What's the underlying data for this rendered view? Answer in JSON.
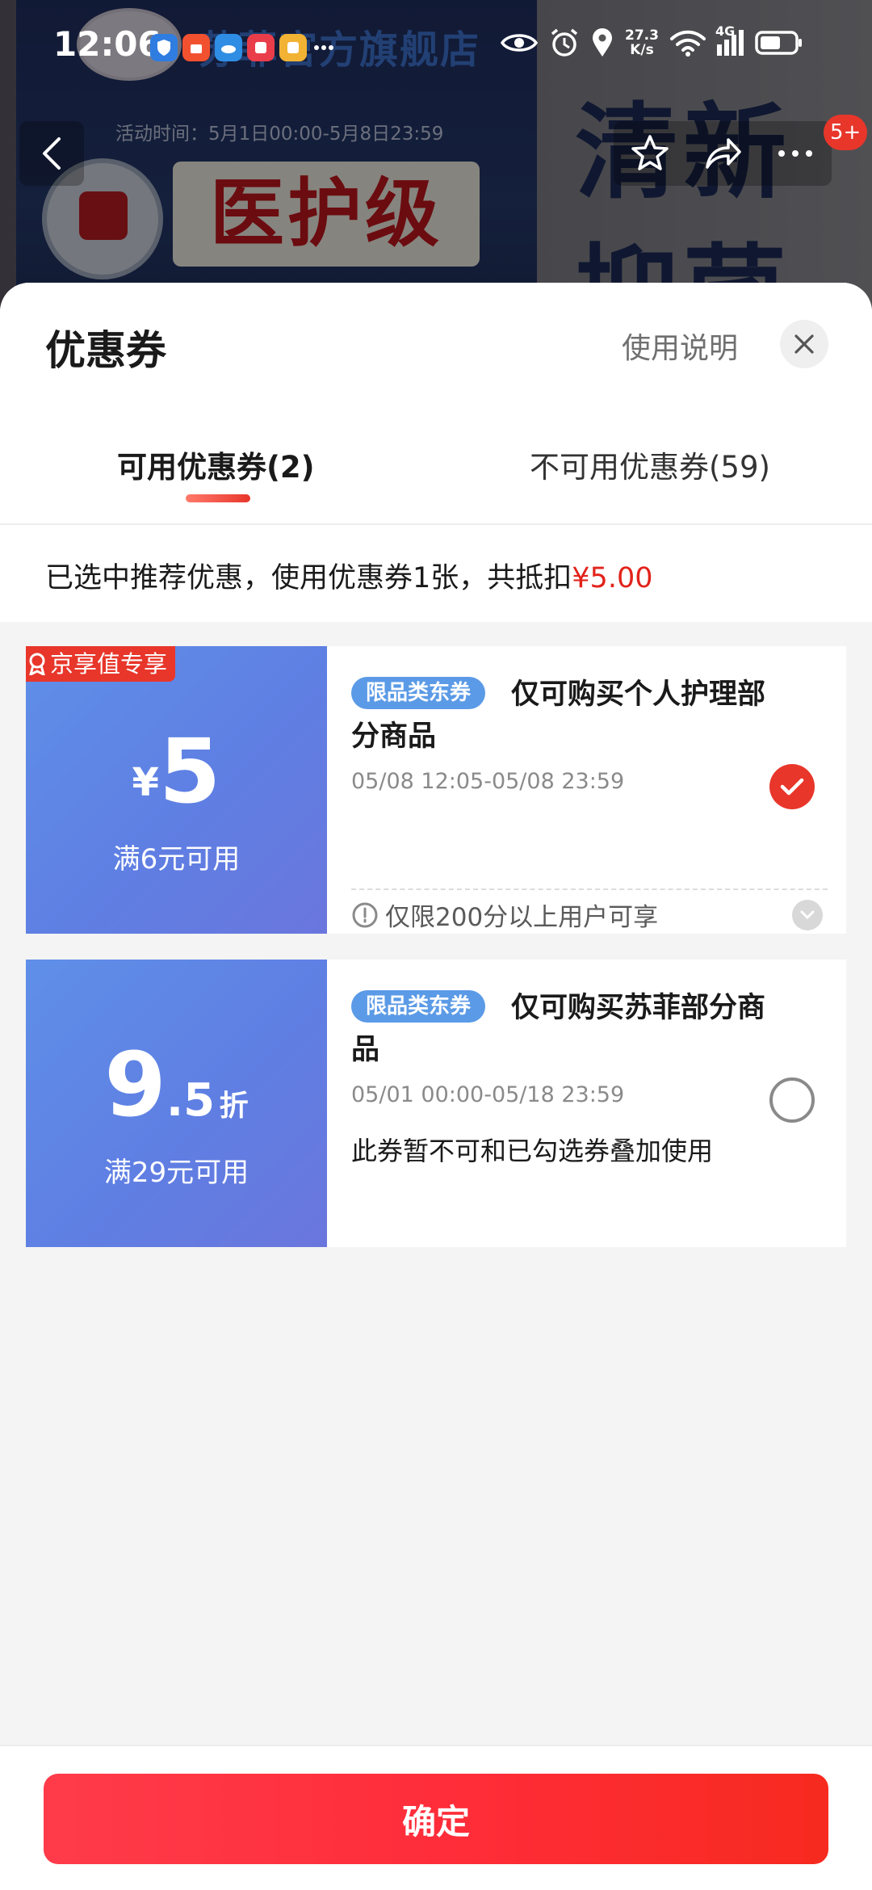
{
  "background": {
    "shop_name": "苏菲官方旗舰店",
    "activity_time": "活动时间：5月1日00:00-5月8日23:59",
    "medical_text": "医护级",
    "fresh_text_1": "清新",
    "fresh_text_2": "抑菌",
    "cart_badge": "5+"
  },
  "status_bar": {
    "time": "12:06",
    "net_speed_value": "27.3",
    "net_speed_unit": "K/s",
    "network": "4G"
  },
  "sheet": {
    "title": "优惠券",
    "instructions_label": "使用说明",
    "tabs": [
      {
        "label": "可用优惠券(2)",
        "active": true
      },
      {
        "label": "不可用优惠券(59)",
        "active": false
      }
    ],
    "summary_prefix": "已选中推荐优惠，使用优惠券1张，共抵扣",
    "summary_amount": "¥5.00"
  },
  "coupons": [
    {
      "exclusive_tag": "京享值专享",
      "currency": "¥",
      "amount": "5",
      "condition": "满6元可用",
      "type_tag": "限品类东券",
      "title": "仅可购买个人护理部分商品",
      "validity": "05/08 12:05-05/08 23:59",
      "limit_note": "仅限200分以上用户可享",
      "selected": true
    },
    {
      "amount_major": "9",
      "amount_minor": ".5",
      "amount_unit": "折",
      "condition": "满29元可用",
      "type_tag": "限品类东券",
      "title": "仅可购买苏菲部分商品",
      "validity": "05/01 00:00-05/18 23:59",
      "note": "此券暂不可和已勾选券叠加使用",
      "selected": false
    }
  ],
  "confirm_label": "确定",
  "colors": {
    "accent_red": "#e8362b",
    "coupon_blue": "#5f8fe8",
    "tag_blue": "#5b9ae6"
  }
}
